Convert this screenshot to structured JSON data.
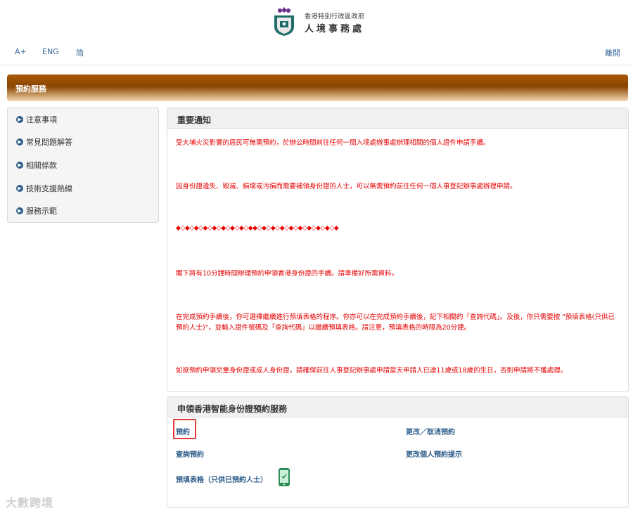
{
  "header": {
    "org_line1": "香港特別行政區政府",
    "org_line2": "人境事務處",
    "lang": [
      "A+",
      "ENG",
      "简"
    ],
    "logout": "離開"
  },
  "banner": {
    "title": "預約服務"
  },
  "sidebar": {
    "items": [
      {
        "label": "注意事項"
      },
      {
        "label": "常見問題解答"
      },
      {
        "label": "相關條款"
      },
      {
        "label": "技術支援熱線"
      },
      {
        "label": "服務示範"
      }
    ]
  },
  "notice": {
    "title": "重要通知",
    "p1": "受大埔火災影響的居民可無需預約，於辦公時間前往任何一間入境處辦事處辦理相關的個人證件申請手續。",
    "p2": "因身份證遺失、毀滅、損壞或污損而需要補領身份證的人士，可以無需預約前往任何一間人事登記辦事處辦理申請。",
    "diamonds": "◆◇◆◇◆◇◆◇◆◇◆◇◆◇◆◇◆◆◇◆◇◆◇◆◇◆◇◆◇◆◇◆◇◆◇◆",
    "p3": "閣下將有10分鐘時間辦理預約申領香港身份證的手續。請準備好所需資料。",
    "p4": "在完成預約手續後，你可選擇繼續進行預填表格的程序。你亦可以在完成預約手續後，記下相關的「查詢代碼」。及後，你只需要按 \"預填表格(只供已預約人士)\"，並輸入證件號碼及「查詢代碼」以繼續預填表格。請注意，預填表格的時限為20分鐘。",
    "p5": "如欲預約申領兒童身份證或成人身份證，請確保前往人事登記辦事處申請當天申請人已達11歲或18歲的生日，否則申請將不獲處理。"
  },
  "service": {
    "title": "申領香港智能身份證預約服務",
    "book": "預約",
    "change": "更改／取消預約",
    "enquire": "查詢預約",
    "reminder": "更改個人預約提示",
    "prefill": "預填表格（只供已預約人士）"
  },
  "watermark": "大數跨境"
}
